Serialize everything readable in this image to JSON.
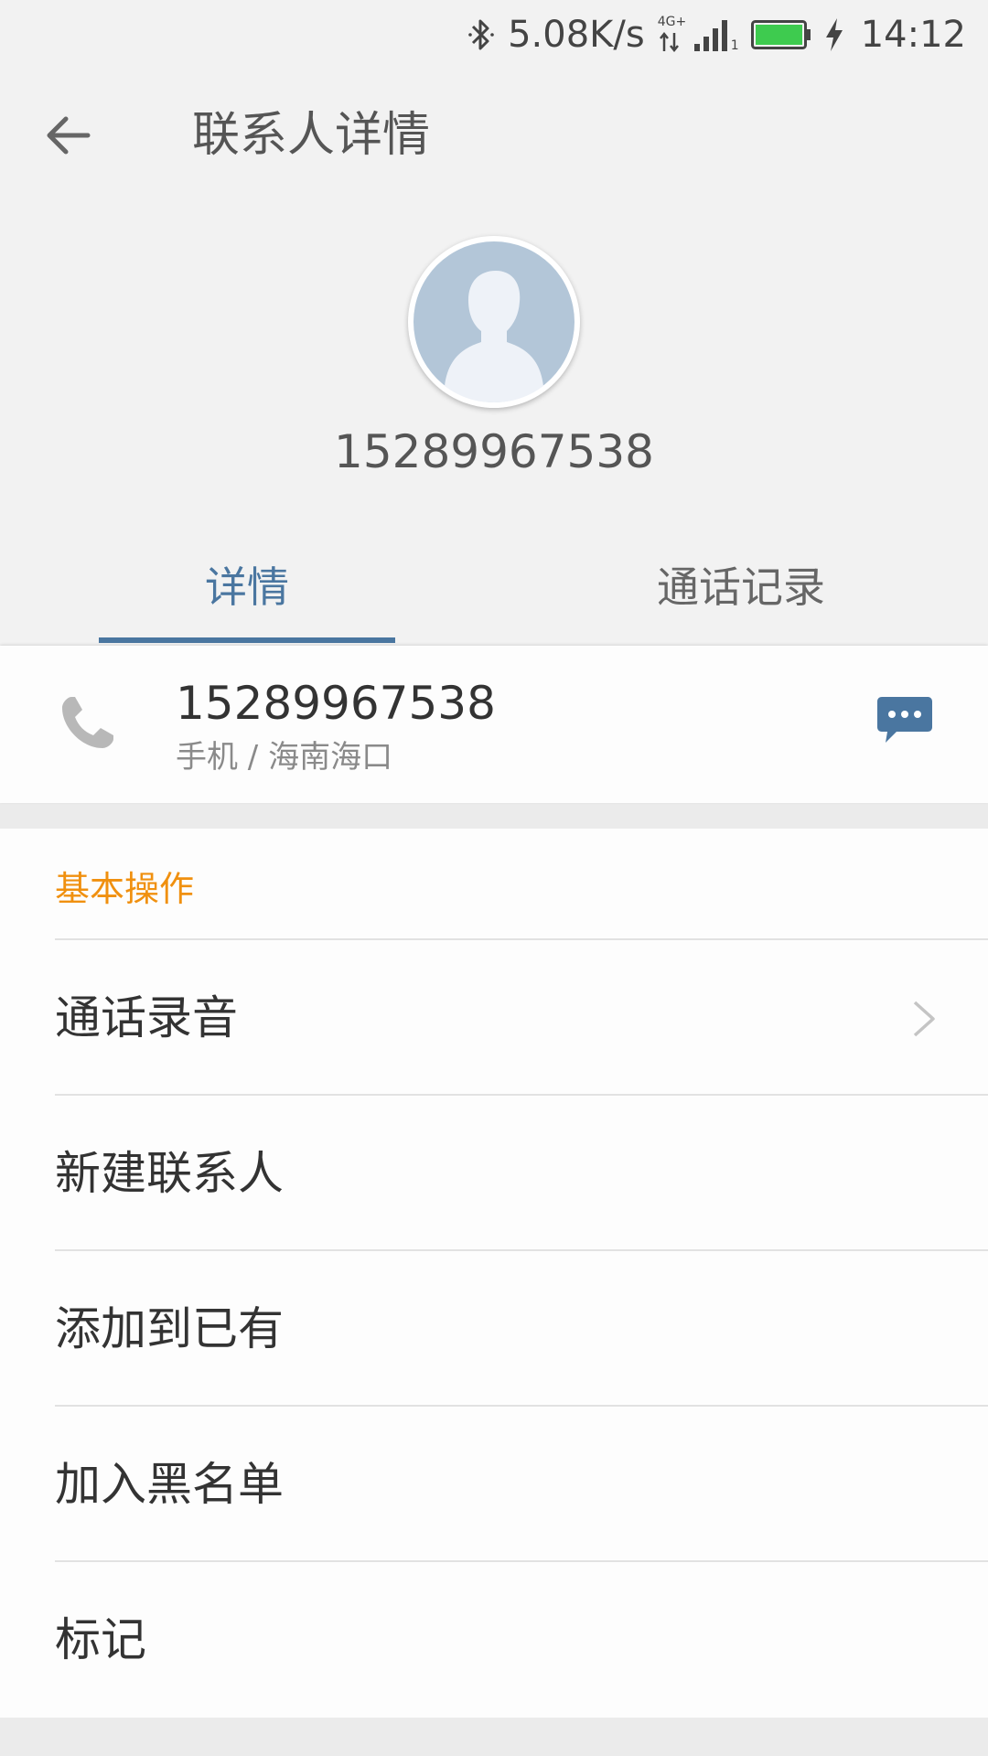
{
  "status_bar": {
    "network_speed": "5.08K/s",
    "network_type": "4G+",
    "sim_slot": "1",
    "time": "14:12",
    "icons": [
      "bluetooth-icon",
      "data-arrows-icon",
      "signal-icon",
      "battery-icon",
      "charging-icon"
    ],
    "battery_color": "#3ecb4f"
  },
  "toolbar": {
    "title": "联系人详情",
    "back_icon": "arrow-left-icon"
  },
  "contact": {
    "name": "15289967538",
    "avatar_icon": "person-silhouette-icon"
  },
  "tabs": [
    {
      "label": "详情",
      "active": true
    },
    {
      "label": "通话记录",
      "active": false
    }
  ],
  "phone": {
    "number": "15289967538",
    "meta": "手机 / 海南海口",
    "call_icon": "phone-handset-icon",
    "message_icon": "message-bubble-icon"
  },
  "basic_actions": {
    "header": "基本操作",
    "items": [
      {
        "label": "通话录音",
        "has_chevron": true
      },
      {
        "label": "新建联系人",
        "has_chevron": false
      },
      {
        "label": "添加到已有",
        "has_chevron": false
      },
      {
        "label": "加入黑名单",
        "has_chevron": false
      },
      {
        "label": "标记",
        "has_chevron": false
      }
    ]
  },
  "colors": {
    "accent_blue": "#4a76a0",
    "section_orange": "#f0900f",
    "avatar_bg": "#b3c6d8"
  }
}
